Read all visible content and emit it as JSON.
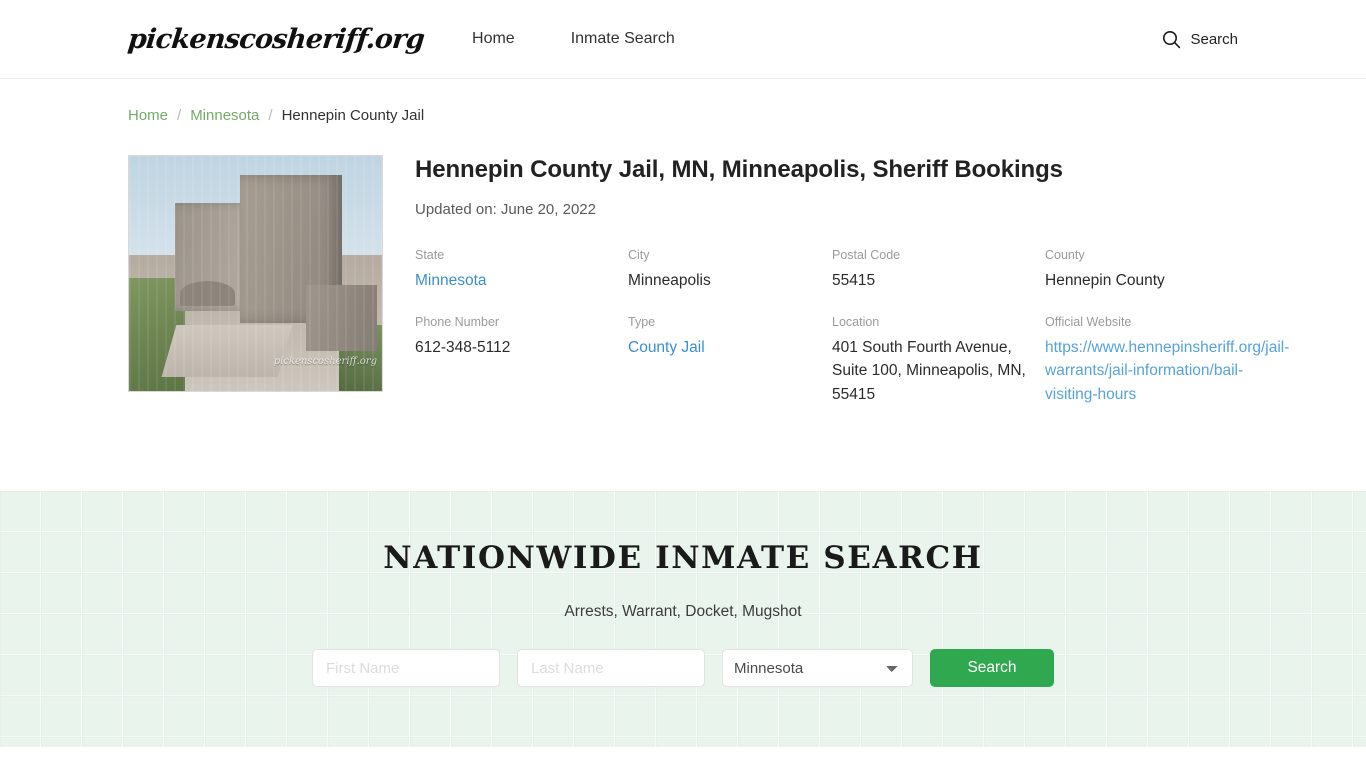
{
  "header": {
    "brand": "pickenscosheriff.org",
    "nav": [
      {
        "label": "Home"
      },
      {
        "label": "Inmate Search"
      }
    ],
    "search": {
      "icon": "search-icon",
      "label": "Search"
    }
  },
  "breadcrumb": {
    "items": [
      {
        "label": "Home",
        "type": "link"
      },
      {
        "label": "Minnesota",
        "type": "link"
      },
      {
        "label": "Hennepin County Jail",
        "type": "current"
      }
    ],
    "separator": "/"
  },
  "facility": {
    "photo_watermark": "pickenscosheriff.org",
    "title": "Hennepin County Jail, MN, Minneapolis, Sheriff Bookings",
    "updated": "Updated on: June 20, 2022",
    "fields": [
      {
        "label": "State",
        "value": "Minnesota",
        "style": "link"
      },
      {
        "label": "City",
        "value": "Minneapolis",
        "style": "text"
      },
      {
        "label": "Postal Code",
        "value": "55415",
        "style": "text"
      },
      {
        "label": "County",
        "value": "Hennepin County",
        "style": "text"
      },
      {
        "label": "Phone Number",
        "value": "612-348-5112",
        "style": "text"
      },
      {
        "label": "Type",
        "value": "County Jail",
        "style": "link"
      },
      {
        "label": "Location",
        "value": "401 South Fourth Avenue, Suite 100, Minneapolis, MN, 55415",
        "style": "text"
      },
      {
        "label": "Official Website",
        "value": "https://www.hennepinsheriff.org/jail-warrants/jail-information/bail-visiting-hours",
        "style": "link-url"
      }
    ]
  },
  "search_band": {
    "title": "NATIONWIDE INMATE SEARCH",
    "subtitle": "Arrests, Warrant, Docket, Mugshot",
    "first_name_placeholder": "First Name",
    "first_name_value": "",
    "last_name_placeholder": "Last Name",
    "last_name_value": "",
    "state_selected": "Minnesota",
    "state_options": [
      "Minnesota"
    ],
    "button_label": "Search"
  },
  "colors": {
    "brand_green": "#2fa84f",
    "crumb_green": "#74ab67",
    "link_blue": "#3b8fd0",
    "url_blue": "#55a3d8",
    "band_bg": "#e9f5ec"
  }
}
